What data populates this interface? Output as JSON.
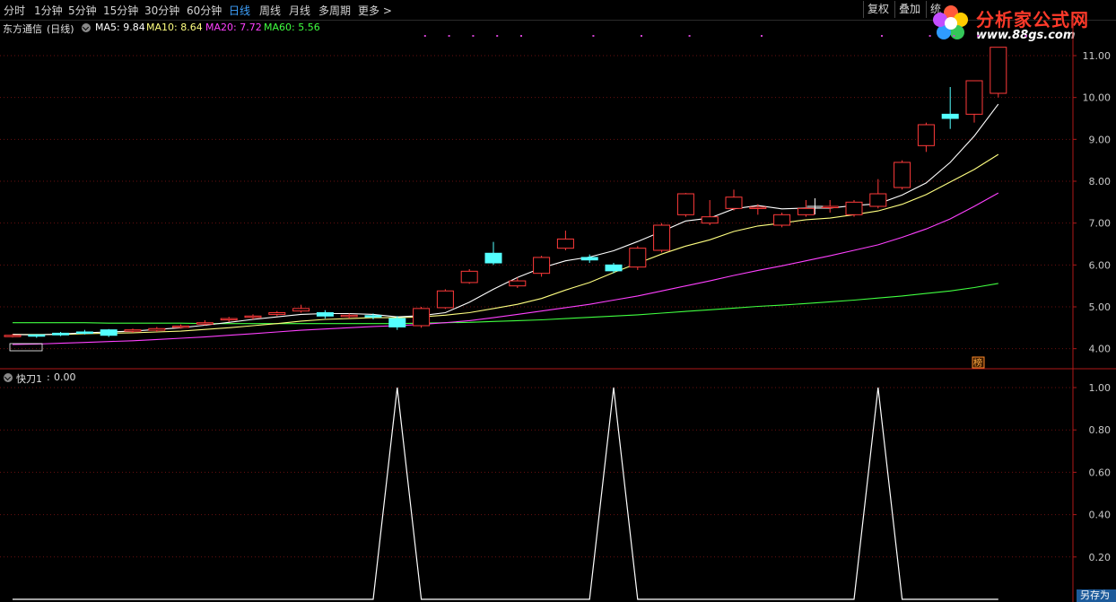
{
  "toolbar": {
    "periods": [
      "分时",
      "1分钟",
      "5分钟",
      "15分钟",
      "30分钟",
      "60分钟",
      "日线",
      "周线",
      "月线",
      "多周期",
      "更多 >"
    ],
    "active_period": "日线",
    "right_buttons": [
      "复权",
      "叠加",
      "统"
    ]
  },
  "logo": {
    "name": "分析家公式网",
    "url": "www.88gs.com"
  },
  "main_chart": {
    "stock_name": "东方通信",
    "period_label": "(日线)",
    "ma5": "MA5: 9.84",
    "ma10": "MA10: 8.64",
    "ma20": "MA20: 7.72",
    "ma60": "MA60: 5.56",
    "price_ticks": [
      "11.00",
      "10.00",
      "9.00",
      "8.00",
      "7.00",
      "6.00",
      "5.00",
      "4.00"
    ],
    "marker_label": "榜",
    "colors": {
      "up": "#ff3a3a",
      "down": "#54ffff",
      "ma5": "#ffffff",
      "ma10": "#ffff80",
      "ma20": "#ff40ff",
      "ma60": "#40ff40"
    }
  },
  "indicator": {
    "label": "快刀1",
    "value": "0.00",
    "ticks": [
      "1.00",
      "0.80",
      "0.60",
      "0.40",
      "0.20"
    ]
  },
  "save_button": "另存为",
  "chart_data": {
    "type": "candlestick",
    "ylim": [
      3.8,
      11.3
    ],
    "candles": [
      [
        4.3,
        4.32,
        4.35,
        4.27
      ],
      [
        4.33,
        4.3,
        4.35,
        4.26
      ],
      [
        4.37,
        4.33,
        4.4,
        4.3
      ],
      [
        4.4,
        4.38,
        4.45,
        4.34
      ],
      [
        4.45,
        4.32,
        4.47,
        4.28
      ],
      [
        4.42,
        4.45,
        4.48,
        4.38
      ],
      [
        4.44,
        4.48,
        4.52,
        4.4
      ],
      [
        4.52,
        4.54,
        4.58,
        4.48
      ],
      [
        4.6,
        4.62,
        4.68,
        4.56
      ],
      [
        4.7,
        4.72,
        4.76,
        4.64
      ],
      [
        4.75,
        4.78,
        4.82,
        4.7
      ],
      [
        4.82,
        4.86,
        4.9,
        4.78
      ],
      [
        4.9,
        4.96,
        5.05,
        4.86
      ],
      [
        4.86,
        4.78,
        4.92,
        4.72
      ],
      [
        4.78,
        4.8,
        4.84,
        4.72
      ],
      [
        4.79,
        4.76,
        4.84,
        4.7
      ],
      [
        4.72,
        4.52,
        4.78,
        4.45
      ],
      [
        4.55,
        4.96,
        5.0,
        4.5
      ],
      [
        4.98,
        5.38,
        5.42,
        4.95
      ],
      [
        5.58,
        5.85,
        5.9,
        5.55
      ],
      [
        6.28,
        6.05,
        6.55,
        6.0
      ],
      [
        5.5,
        5.62,
        5.7,
        5.45
      ],
      [
        5.8,
        6.18,
        6.22,
        5.72
      ],
      [
        6.4,
        6.62,
        6.82,
        6.35
      ],
      [
        6.18,
        6.12,
        6.25,
        6.05
      ],
      [
        6.0,
        5.86,
        6.05,
        5.8
      ],
      [
        5.95,
        6.4,
        6.45,
        5.88
      ],
      [
        6.35,
        6.95,
        7.0,
        6.3
      ],
      [
        7.2,
        7.7,
        7.72,
        7.15
      ],
      [
        7.0,
        7.15,
        7.55,
        6.95
      ],
      [
        7.35,
        7.62,
        7.8,
        7.3
      ],
      [
        7.35,
        7.38,
        7.45,
        7.2
      ],
      [
        6.95,
        7.2,
        7.25,
        6.9
      ],
      [
        7.2,
        7.35,
        7.55,
        7.15
      ],
      [
        7.38,
        7.4,
        7.55,
        7.25
      ],
      [
        7.2,
        7.5,
        7.55,
        7.15
      ],
      [
        7.4,
        7.7,
        8.05,
        7.35
      ],
      [
        7.85,
        8.45,
        8.5,
        7.8
      ],
      [
        8.85,
        9.35,
        9.4,
        8.7
      ],
      [
        9.6,
        9.5,
        10.25,
        9.25
      ],
      [
        9.6,
        10.4,
        10.4,
        9.4
      ],
      [
        10.1,
        11.2,
        11.2,
        10.0
      ]
    ],
    "ma5": [
      4.34,
      4.33,
      4.35,
      4.38,
      4.4,
      4.42,
      4.46,
      4.5,
      4.56,
      4.63,
      4.7,
      4.76,
      4.82,
      4.84,
      4.84,
      4.82,
      4.76,
      4.79,
      4.86,
      5.11,
      5.42,
      5.7,
      5.93,
      6.1,
      6.19,
      6.34,
      6.56,
      6.8,
      7.05,
      7.12,
      7.34,
      7.42,
      7.34,
      7.36,
      7.36,
      7.42,
      7.46,
      7.67,
      7.96,
      8.45,
      9.08,
      9.84
    ],
    "ma10": [
      4.34,
      4.34,
      4.34,
      4.36,
      4.37,
      4.38,
      4.4,
      4.42,
      4.46,
      4.5,
      4.55,
      4.6,
      4.66,
      4.7,
      4.72,
      4.74,
      4.74,
      4.76,
      4.8,
      4.86,
      4.96,
      5.06,
      5.2,
      5.4,
      5.58,
      5.82,
      6.04,
      6.26,
      6.45,
      6.6,
      6.8,
      6.93,
      7.0,
      7.08,
      7.12,
      7.2,
      7.29,
      7.45,
      7.68,
      7.98,
      8.28,
      8.64
    ],
    "ma20": [
      4.1,
      4.11,
      4.13,
      4.15,
      4.17,
      4.19,
      4.22,
      4.25,
      4.28,
      4.32,
      4.36,
      4.4,
      4.44,
      4.47,
      4.5,
      4.53,
      4.55,
      4.58,
      4.62,
      4.67,
      4.74,
      4.82,
      4.9,
      4.98,
      5.06,
      5.16,
      5.26,
      5.38,
      5.5,
      5.62,
      5.75,
      5.87,
      5.98,
      6.1,
      6.22,
      6.35,
      6.48,
      6.66,
      6.86,
      7.1,
      7.4,
      7.72
    ],
    "ma60": [
      4.62,
      4.62,
      4.62,
      4.62,
      4.61,
      4.61,
      4.61,
      4.61,
      4.6,
      4.6,
      4.6,
      4.6,
      4.6,
      4.6,
      4.6,
      4.6,
      4.6,
      4.61,
      4.62,
      4.63,
      4.65,
      4.67,
      4.69,
      4.72,
      4.75,
      4.78,
      4.81,
      4.85,
      4.89,
      4.93,
      4.97,
      5.01,
      5.04,
      5.08,
      5.12,
      5.16,
      5.21,
      5.26,
      5.32,
      5.38,
      5.46,
      5.56
    ],
    "signal_peaks_at_index": [
      16,
      25,
      36
    ],
    "signal_ylim": [
      0,
      1
    ]
  }
}
